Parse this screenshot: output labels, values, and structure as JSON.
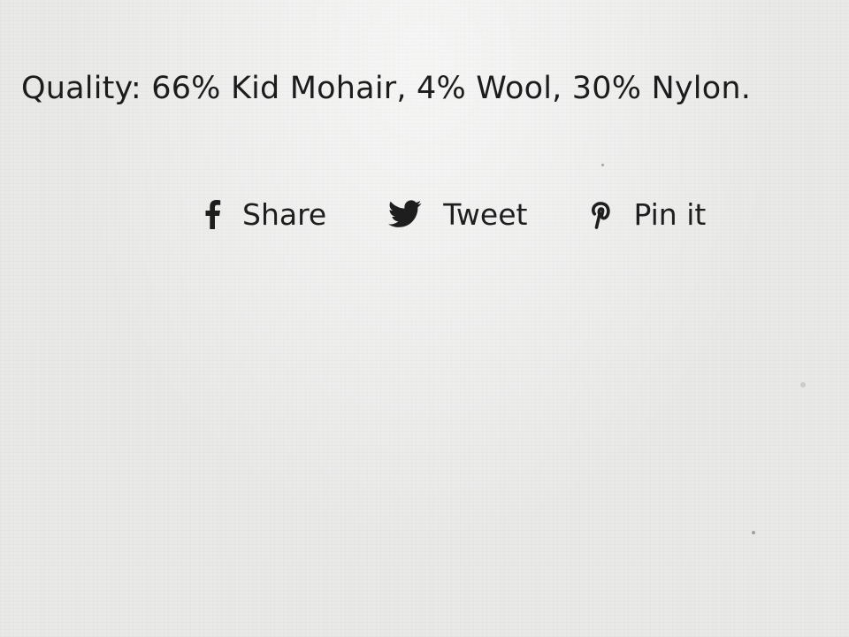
{
  "product": {
    "quality_text": "Quality: 66% Kid Mohair, 4% Wool, 30% Nylon."
  },
  "share_bar": {
    "items": [
      {
        "label": "Share",
        "icon": "facebook-icon"
      },
      {
        "label": "Tweet",
        "icon": "twitter-icon"
      },
      {
        "label": "Pin it",
        "icon": "pinterest-icon"
      }
    ]
  },
  "colors": {
    "text": "#1e1e1e",
    "background": "#e9eae8"
  }
}
